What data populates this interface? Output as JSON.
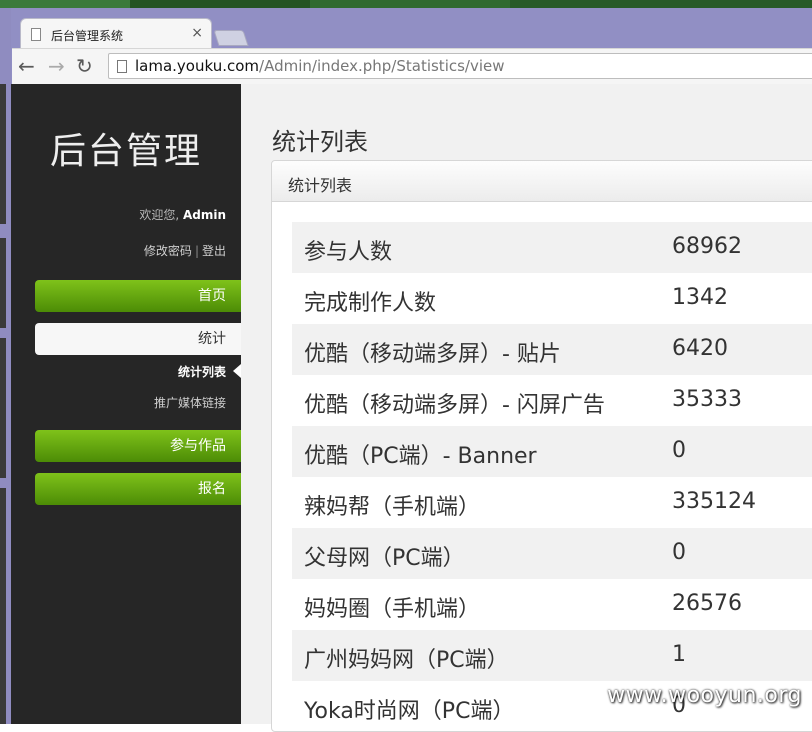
{
  "browser": {
    "tab_title": "后台管理系统",
    "tab_close": "×",
    "url_host": "lama.youku.com",
    "url_path": "/Admin/index.php/Statistics/view"
  },
  "sidebar": {
    "brand": "后台管理",
    "welcome_prefix": "欢迎您, ",
    "welcome_user": "Admin",
    "change_password": "修改密码",
    "logout": "登出",
    "nav": [
      {
        "label": "首页"
      },
      {
        "label": "统计"
      },
      {
        "label": "参与作品"
      },
      {
        "label": "报名"
      }
    ],
    "sub": [
      {
        "label": "统计列表"
      },
      {
        "label": "推广媒体链接"
      }
    ]
  },
  "content": {
    "page_title": "统计列表",
    "panel_title": "统计列表",
    "rows": [
      {
        "k": "参与人数",
        "v": "68962"
      },
      {
        "k": "完成制作人数",
        "v": "1342"
      },
      {
        "k": "优酷（移动端多屏）- 贴片",
        "v": "6420"
      },
      {
        "k": "优酷（移动端多屏）- 闪屏广告",
        "v": "35333"
      },
      {
        "k": "优酷（PC端）- Banner",
        "v": "0"
      },
      {
        "k": "辣妈帮（手机端）",
        "v": "335124"
      },
      {
        "k": "父母网（PC端）",
        "v": "0"
      },
      {
        "k": "妈妈圈（手机端）",
        "v": "26576"
      },
      {
        "k": "广州妈妈网（PC端）",
        "v": "1"
      },
      {
        "k": "Yoka时尚网（PC端）",
        "v": "0"
      }
    ]
  },
  "watermark": "www.wooyun.org",
  "colors": {
    "sidebar_bg": "#262626",
    "nav_green": "#5fa40f",
    "content_bg": "#f1f1f1",
    "chrome": "#918fc4"
  }
}
